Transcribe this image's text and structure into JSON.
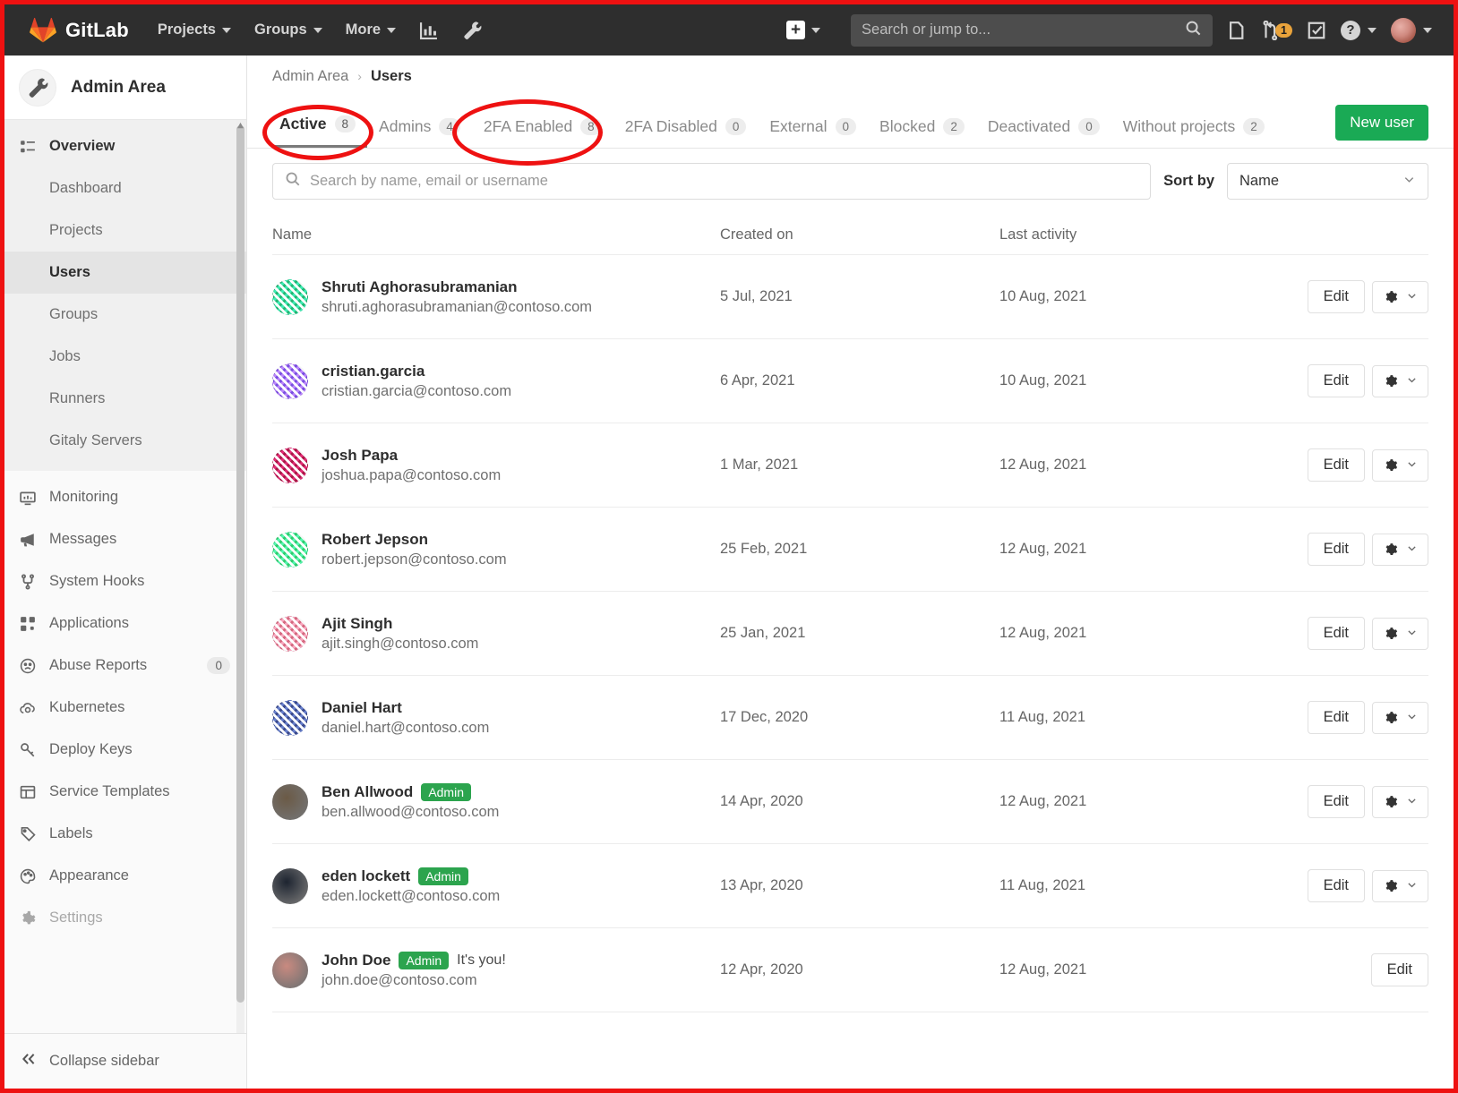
{
  "topnav": {
    "brand": "GitLab",
    "links": [
      {
        "label": "Projects",
        "name": "nav-projects"
      },
      {
        "label": "Groups",
        "name": "nav-groups"
      },
      {
        "label": "More",
        "name": "nav-more"
      }
    ],
    "search_placeholder": "Search or jump to...",
    "merge_request_count": "1"
  },
  "sidebar": {
    "title": "Admin Area",
    "overview_label": "Overview",
    "sub_items": [
      {
        "label": "Dashboard",
        "active": false
      },
      {
        "label": "Projects",
        "active": false
      },
      {
        "label": "Users",
        "active": true
      },
      {
        "label": "Groups",
        "active": false
      },
      {
        "label": "Jobs",
        "active": false
      },
      {
        "label": "Runners",
        "active": false
      },
      {
        "label": "Gitaly Servers",
        "active": false
      }
    ],
    "items": [
      {
        "label": "Monitoring",
        "icon": "monitor-icon",
        "count": ""
      },
      {
        "label": "Messages",
        "icon": "megaphone-icon",
        "count": ""
      },
      {
        "label": "System Hooks",
        "icon": "hook-icon",
        "count": ""
      },
      {
        "label": "Applications",
        "icon": "apps-grid-icon",
        "count": ""
      },
      {
        "label": "Abuse Reports",
        "icon": "frown-face-icon",
        "count": "0"
      },
      {
        "label": "Kubernetes",
        "icon": "kubernetes-cloud-icon",
        "count": ""
      },
      {
        "label": "Deploy Keys",
        "icon": "key-icon",
        "count": ""
      },
      {
        "label": "Service Templates",
        "icon": "template-icon",
        "count": ""
      },
      {
        "label": "Labels",
        "icon": "label-tag-icon",
        "count": ""
      },
      {
        "label": "Appearance",
        "icon": "palette-icon",
        "count": ""
      },
      {
        "label": "Settings",
        "icon": "gear-icon",
        "count": ""
      }
    ],
    "collapse_label": "Collapse sidebar"
  },
  "breadcrumb": {
    "parent": "Admin Area",
    "separator": "›",
    "current": "Users"
  },
  "tabs": [
    {
      "label": "Active",
      "count": "8",
      "active": true
    },
    {
      "label": "Admins",
      "count": "4",
      "active": false
    },
    {
      "label": "2FA Enabled",
      "count": "8",
      "active": false
    },
    {
      "label": "2FA Disabled",
      "count": "0",
      "active": false
    },
    {
      "label": "External",
      "count": "0",
      "active": false
    },
    {
      "label": "Blocked",
      "count": "2",
      "active": false
    },
    {
      "label": "Deactivated",
      "count": "0",
      "active": false
    },
    {
      "label": "Without projects",
      "count": "2",
      "active": false
    }
  ],
  "new_user_button": "New user",
  "search": {
    "placeholder": "Search by name, email or username",
    "value": ""
  },
  "sort": {
    "label": "Sort by",
    "selected": "Name"
  },
  "table": {
    "headers": {
      "name": "Name",
      "created": "Created on",
      "activity": "Last activity"
    },
    "edit_label": "Edit",
    "rows": [
      {
        "name": "Shruti Aghorasubramanian",
        "email": "shruti.aghorasubramanian@contoso.com",
        "created": "5 Jul, 2021",
        "activity": "10 Aug, 2021",
        "admin": false,
        "its_you": "",
        "avatar_type": "identicon",
        "avatar_color": "#22b573",
        "show_gear": true
      },
      {
        "name": "cristian.garcia",
        "email": "cristian.garcia@contoso.com",
        "created": "6 Apr, 2021",
        "activity": "10 Aug, 2021",
        "admin": false,
        "its_you": "",
        "avatar_type": "identicon",
        "avatar_color": "#7a4fe0",
        "show_gear": true
      },
      {
        "name": "Josh Papa",
        "email": "joshua.papa@contoso.com",
        "created": "1 Mar, 2021",
        "activity": "12 Aug, 2021",
        "admin": false,
        "its_you": "",
        "avatar_type": "identicon",
        "avatar_color": "#a81845",
        "show_gear": true
      },
      {
        "name": "Robert Jepson",
        "email": "robert.jepson@contoso.com",
        "created": "25 Feb, 2021",
        "activity": "12 Aug, 2021",
        "admin": false,
        "its_you": "",
        "avatar_type": "identicon",
        "avatar_color": "#2fcc6e",
        "show_gear": true
      },
      {
        "name": "Ajit Singh",
        "email": "ajit.singh@contoso.com",
        "created": "25 Jan, 2021",
        "activity": "12 Aug, 2021",
        "admin": false,
        "its_you": "",
        "avatar_type": "identicon",
        "avatar_color": "#d4697f",
        "show_gear": true
      },
      {
        "name": "Daniel Hart",
        "email": "daniel.hart@contoso.com",
        "created": "17 Dec, 2020",
        "activity": "11 Aug, 2021",
        "admin": false,
        "its_you": "",
        "avatar_type": "identicon",
        "avatar_color": "#3b4a8c",
        "show_gear": true
      },
      {
        "name": "Ben Allwood",
        "email": "ben.allwood@contoso.com",
        "created": "14 Apr, 2020",
        "activity": "12 Aug, 2021",
        "admin": true,
        "admin_label": "Admin",
        "its_you": "",
        "avatar_type": "photo",
        "avatar_color": "#6b5a46",
        "show_gear": true
      },
      {
        "name": "eden lockett",
        "email": "eden.lockett@contoso.com",
        "created": "13 Apr, 2020",
        "activity": "11 Aug, 2021",
        "admin": true,
        "admin_label": "Admin",
        "its_you": "",
        "avatar_type": "photo",
        "avatar_color": "#1d2430",
        "show_gear": true
      },
      {
        "name": "John Doe",
        "email": "john.doe@contoso.com",
        "created": "12 Apr, 2020",
        "activity": "12 Aug, 2021",
        "admin": true,
        "admin_label": "Admin",
        "its_you": "It's you!",
        "avatar_type": "photo",
        "avatar_color": "#c98a80",
        "show_gear": false
      }
    ]
  },
  "colors": {
    "accent_green": "#1aaa55",
    "nav_dark": "#2e2e2e",
    "annotation_red": "#ee1111"
  }
}
